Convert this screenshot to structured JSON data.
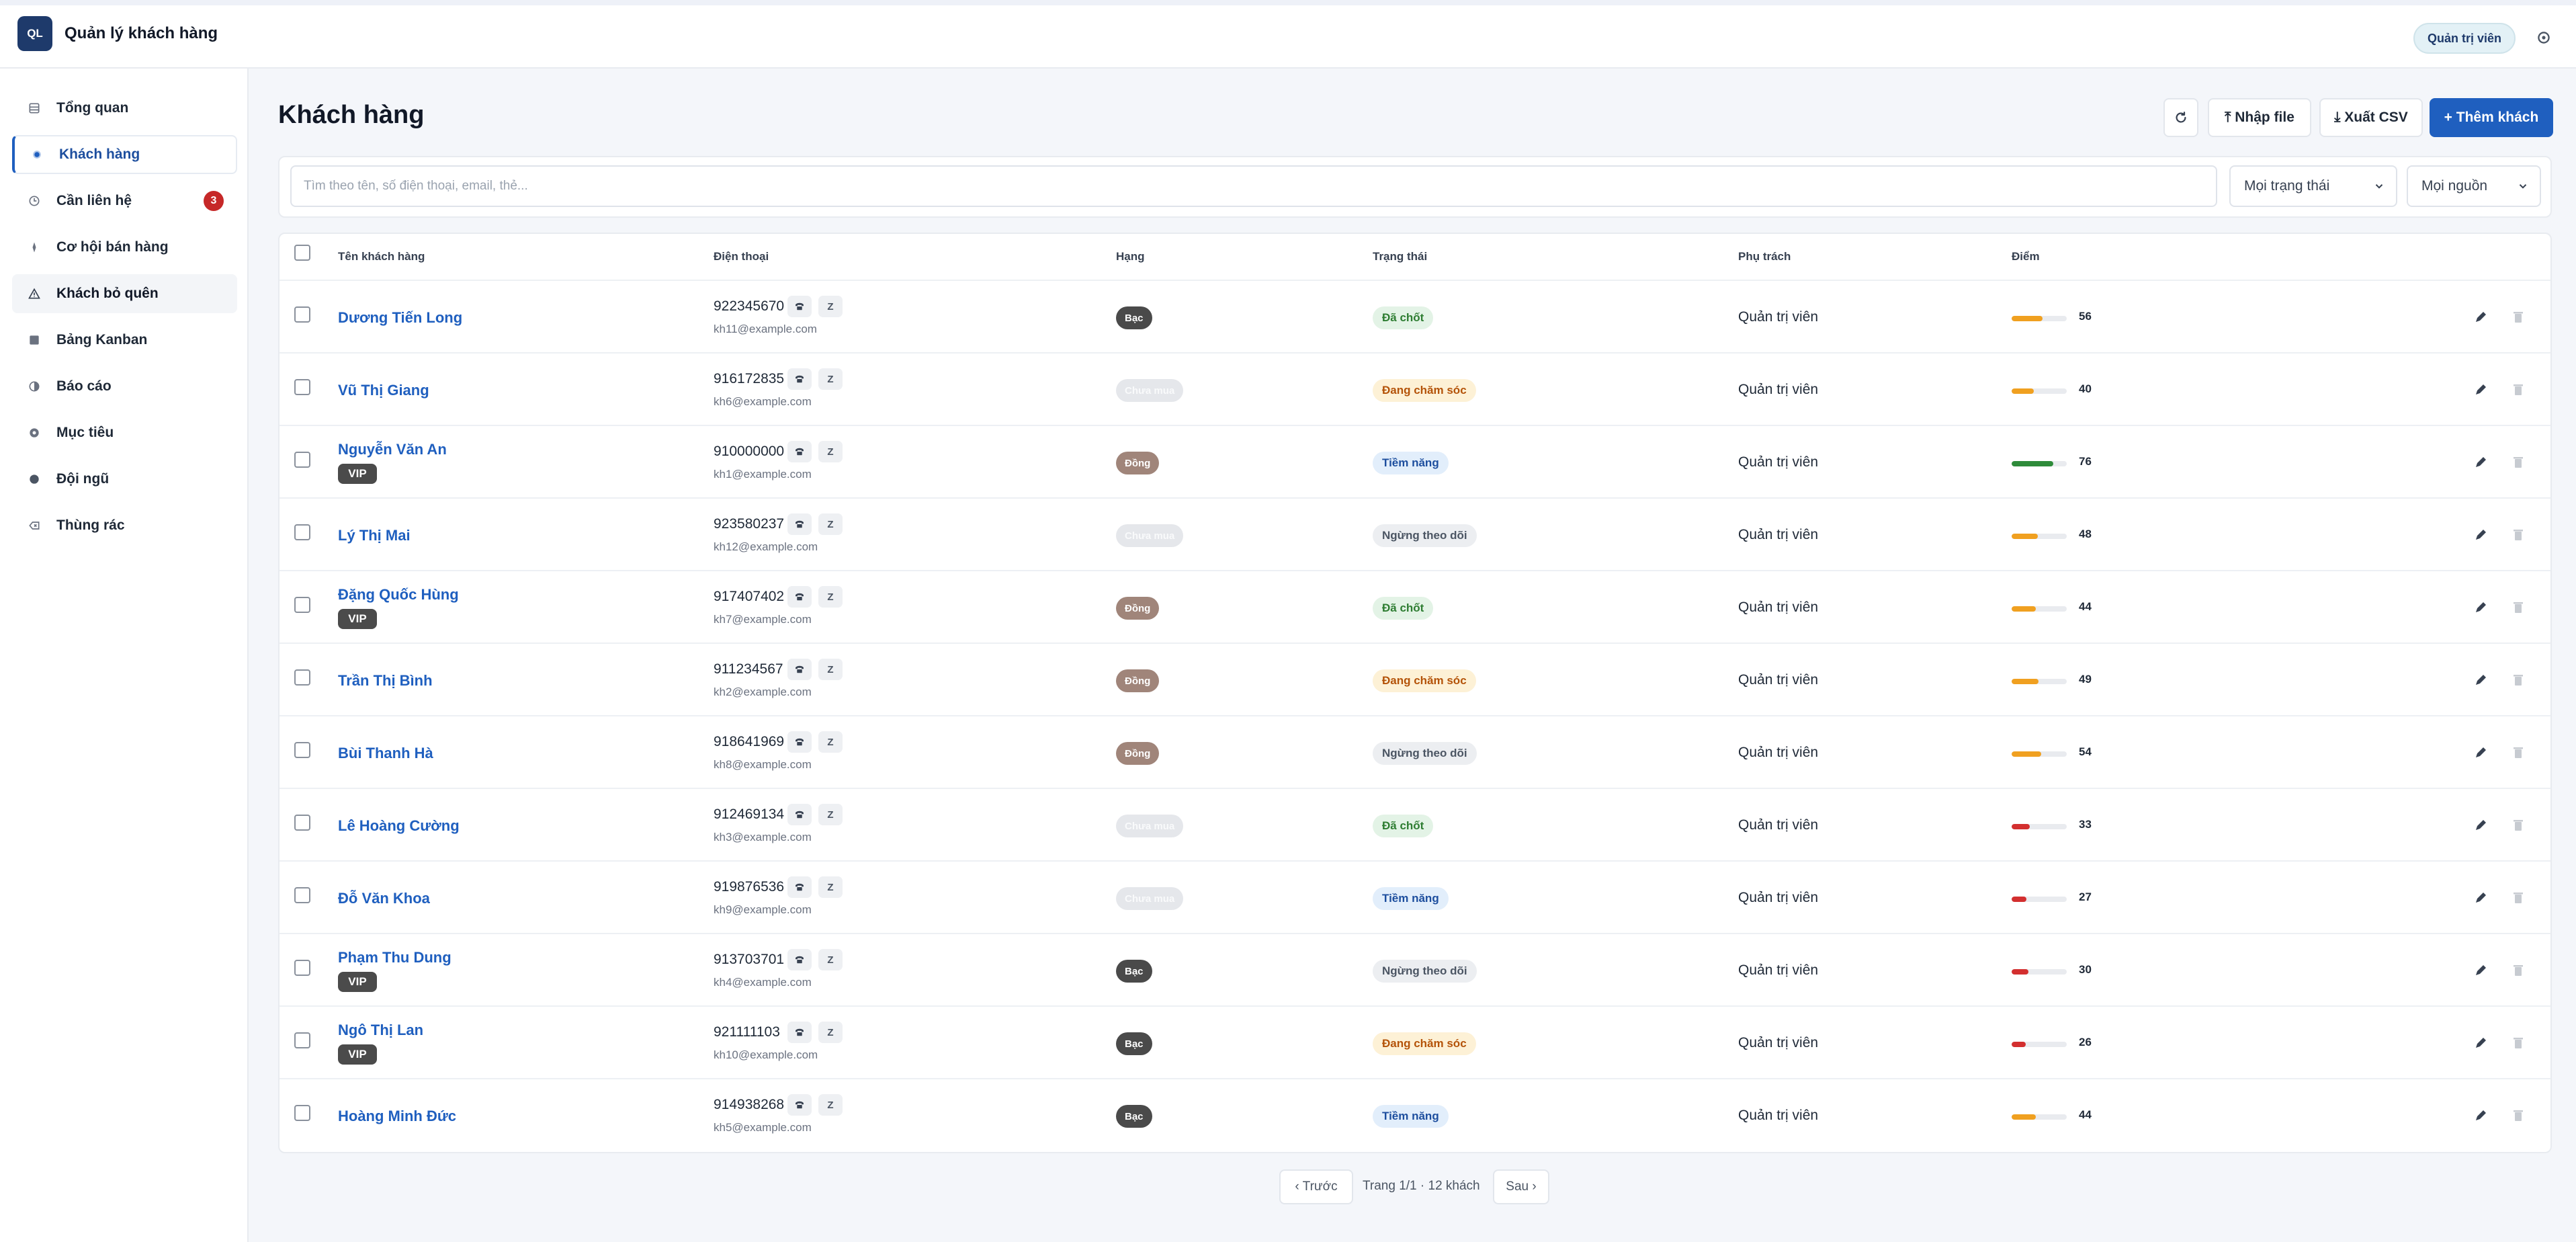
{
  "app": {
    "logo_text": "QL",
    "title": "Quản lý khách hàng",
    "role": "Quản trị viên"
  },
  "sidebar": {
    "items": [
      {
        "label": "Tổng quan",
        "icon": "dashboard-icon"
      },
      {
        "label": "Khách hàng",
        "icon": "users-icon",
        "active": true
      },
      {
        "label": "Cần liên hệ",
        "icon": "clock-icon",
        "badge": "3"
      },
      {
        "label": "Cơ hội bán hàng",
        "icon": "target-icon"
      },
      {
        "label": "Khách bỏ quên",
        "icon": "warning-icon",
        "hovered": true
      },
      {
        "label": "Bảng Kanban",
        "icon": "kanban-icon"
      },
      {
        "label": "Báo cáo",
        "icon": "chart-icon"
      },
      {
        "label": "Mục tiêu",
        "icon": "goal-icon"
      },
      {
        "label": "Đội ngũ",
        "icon": "team-icon"
      },
      {
        "label": "Thùng rác",
        "icon": "trash-bin-icon"
      }
    ]
  },
  "page": {
    "title": "Khách hàng"
  },
  "toolbar": {
    "import_label": "⤒ Nhập file",
    "export_label": "⤓ Xuất CSV",
    "add_label": "+ Thêm khách"
  },
  "filters": {
    "search_placeholder": "Tìm theo tên, số điện thoại, email, thẻ...",
    "status_value": "Mọi trạng thái",
    "source_value": "Mọi nguồn"
  },
  "table": {
    "headers": {
      "name": "Tên khách hàng",
      "phone": "Điện thoại",
      "rank": "Hạng",
      "status": "Trạng thái",
      "owner": "Phụ trách",
      "score": "Điểm"
    },
    "rows": [
      {
        "name": "Dương Tiến Long",
        "vip": false,
        "phone": "922345670",
        "email": "kh11@example.com",
        "rank": "Bạc",
        "rank_type": "bac",
        "status": "Đã chốt",
        "status_type": "dachot",
        "owner": "Quản trị viên",
        "score": 56,
        "score_color": "#f0a020"
      },
      {
        "name": "Vũ Thị Giang",
        "vip": false,
        "phone": "916172835",
        "email": "kh6@example.com",
        "rank": "Chưa mua",
        "rank_type": "chua",
        "status": "Đang chăm sóc",
        "status_type": "cham",
        "owner": "Quản trị viên",
        "score": 40,
        "score_color": "#f0a020"
      },
      {
        "name": "Nguyễn Văn An",
        "vip": true,
        "vip_label": "VIP",
        "phone": "910000000",
        "email": "kh1@example.com",
        "rank": "Đồng",
        "rank_type": "dong",
        "status": "Tiềm năng",
        "status_type": "tiem",
        "owner": "Quản trị viên",
        "score": 76,
        "score_color": "#2e8b3a"
      },
      {
        "name": "Lý Thị Mai",
        "vip": false,
        "phone": "923580237",
        "email": "kh12@example.com",
        "rank": "Chưa mua",
        "rank_type": "chua",
        "status": "Ngừng theo dõi",
        "status_type": "ngung",
        "owner": "Quản trị viên",
        "score": 48,
        "score_color": "#f0a020"
      },
      {
        "name": "Đặng Quốc Hùng",
        "vip": true,
        "vip_label": "VIP",
        "phone": "917407402",
        "email": "kh7@example.com",
        "rank": "Đồng",
        "rank_type": "dong",
        "status": "Đã chốt",
        "status_type": "dachot",
        "owner": "Quản trị viên",
        "score": 44,
        "score_color": "#f0a020"
      },
      {
        "name": "Trần Thị Bình",
        "vip": false,
        "phone": "911234567",
        "email": "kh2@example.com",
        "rank": "Đồng",
        "rank_type": "dong",
        "status": "Đang chăm sóc",
        "status_type": "cham",
        "owner": "Quản trị viên",
        "score": 49,
        "score_color": "#f0a020"
      },
      {
        "name": "Bùi Thanh Hà",
        "vip": false,
        "phone": "918641969",
        "email": "kh8@example.com",
        "rank": "Đồng",
        "rank_type": "dong",
        "status": "Ngừng theo dõi",
        "status_type": "ngung",
        "owner": "Quản trị viên",
        "score": 54,
        "score_color": "#f0a020"
      },
      {
        "name": "Lê Hoàng Cường",
        "vip": false,
        "phone": "912469134",
        "email": "kh3@example.com",
        "rank": "Chưa mua",
        "rank_type": "chua",
        "status": "Đã chốt",
        "status_type": "dachot",
        "owner": "Quản trị viên",
        "score": 33,
        "score_color": "#d32f2f"
      },
      {
        "name": "Đỗ Văn Khoa",
        "vip": false,
        "phone": "919876536",
        "email": "kh9@example.com",
        "rank": "Chưa mua",
        "rank_type": "chua",
        "status": "Tiềm năng",
        "status_type": "tiem",
        "owner": "Quản trị viên",
        "score": 27,
        "score_color": "#d32f2f"
      },
      {
        "name": "Phạm Thu Dung",
        "vip": true,
        "vip_label": "VIP",
        "phone": "913703701",
        "email": "kh4@example.com",
        "rank": "Bạc",
        "rank_type": "bac",
        "status": "Ngừng theo dõi",
        "status_type": "ngung",
        "owner": "Quản trị viên",
        "score": 30,
        "score_color": "#d32f2f"
      },
      {
        "name": "Ngô Thị Lan",
        "vip": true,
        "vip_label": "VIP",
        "phone": "921111103",
        "email": "kh10@example.com",
        "rank": "Bạc",
        "rank_type": "bac",
        "status": "Đang chăm sóc",
        "status_type": "cham",
        "owner": "Quản trị viên",
        "score": 26,
        "score_color": "#d32f2f"
      },
      {
        "name": "Hoàng Minh Đức",
        "vip": false,
        "phone": "914938268",
        "email": "kh5@example.com",
        "rank": "Bạc",
        "rank_type": "bac",
        "status": "Tiềm năng",
        "status_type": "tiem",
        "owner": "Quản trị viên",
        "score": 44,
        "score_color": "#f0a020"
      }
    ]
  },
  "row_actions": {
    "call_icon": "phone-icon",
    "zalo_label": "Z",
    "edit_icon": "edit-icon",
    "delete_icon": "trash-icon"
  },
  "pagination": {
    "prev_label": "‹ Trước",
    "info": "Trang 1/1 · 12 khách",
    "next_label": "Sau ›"
  },
  "colors": {
    "accent": "#1f5fbf",
    "brand_dark": "#1e3a6b",
    "badge_red": "#c62828"
  }
}
